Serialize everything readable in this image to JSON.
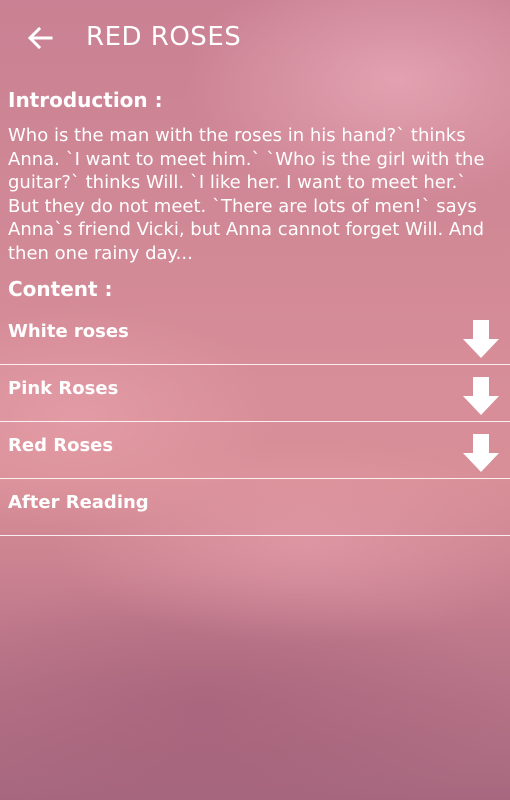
{
  "appbar": {
    "title": "RED ROSES",
    "back_icon": "arrow-left-icon"
  },
  "introduction": {
    "heading": "Introduction :",
    "text": "Who is the man with the roses in his hand?` thinks Anna. `I want to meet him.` `Who is the girl with the guitar?` thinks Will. `I like her. I want to meet her.` But they do not meet. `There are lots of men!` says Anna`s friend Vicki, but Anna cannot forget Will. And then one rainy day..."
  },
  "content": {
    "heading": "Content :",
    "items": [
      {
        "label": "White roses",
        "icon": "download-arrow-icon"
      },
      {
        "label": "Pink Roses",
        "icon": "download-arrow-icon"
      },
      {
        "label": "Red Roses",
        "icon": "download-arrow-icon"
      },
      {
        "label": "After Reading",
        "icon": ""
      }
    ]
  },
  "colors": {
    "text": "#ffffff",
    "background_top": "#c98193",
    "background_bottom": "#a7687f"
  }
}
